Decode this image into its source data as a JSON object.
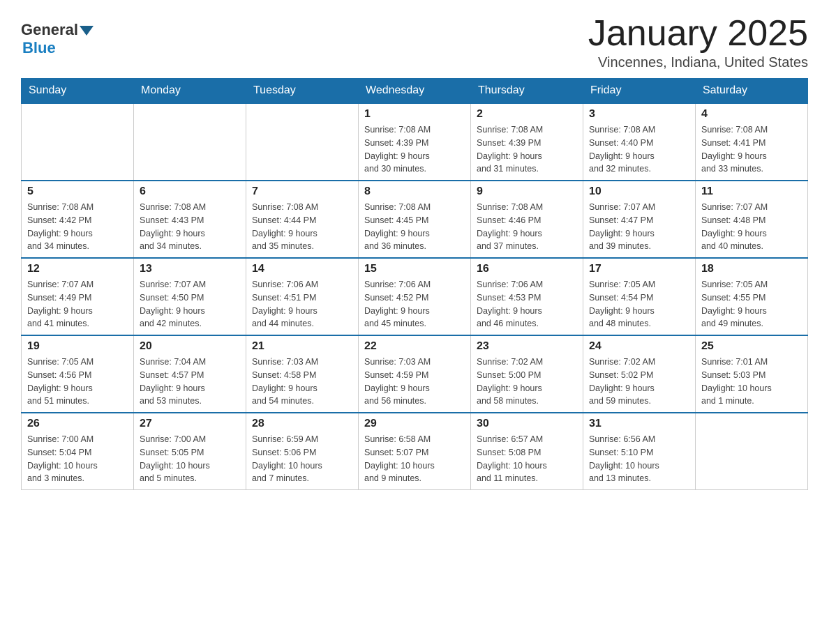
{
  "header": {
    "logo_general": "General",
    "logo_blue": "Blue",
    "month_title": "January 2025",
    "location": "Vincennes, Indiana, United States"
  },
  "days_of_week": [
    "Sunday",
    "Monday",
    "Tuesday",
    "Wednesday",
    "Thursday",
    "Friday",
    "Saturday"
  ],
  "weeks": [
    [
      {
        "day": "",
        "info": ""
      },
      {
        "day": "",
        "info": ""
      },
      {
        "day": "",
        "info": ""
      },
      {
        "day": "1",
        "info": "Sunrise: 7:08 AM\nSunset: 4:39 PM\nDaylight: 9 hours\nand 30 minutes."
      },
      {
        "day": "2",
        "info": "Sunrise: 7:08 AM\nSunset: 4:39 PM\nDaylight: 9 hours\nand 31 minutes."
      },
      {
        "day": "3",
        "info": "Sunrise: 7:08 AM\nSunset: 4:40 PM\nDaylight: 9 hours\nand 32 minutes."
      },
      {
        "day": "4",
        "info": "Sunrise: 7:08 AM\nSunset: 4:41 PM\nDaylight: 9 hours\nand 33 minutes."
      }
    ],
    [
      {
        "day": "5",
        "info": "Sunrise: 7:08 AM\nSunset: 4:42 PM\nDaylight: 9 hours\nand 34 minutes."
      },
      {
        "day": "6",
        "info": "Sunrise: 7:08 AM\nSunset: 4:43 PM\nDaylight: 9 hours\nand 34 minutes."
      },
      {
        "day": "7",
        "info": "Sunrise: 7:08 AM\nSunset: 4:44 PM\nDaylight: 9 hours\nand 35 minutes."
      },
      {
        "day": "8",
        "info": "Sunrise: 7:08 AM\nSunset: 4:45 PM\nDaylight: 9 hours\nand 36 minutes."
      },
      {
        "day": "9",
        "info": "Sunrise: 7:08 AM\nSunset: 4:46 PM\nDaylight: 9 hours\nand 37 minutes."
      },
      {
        "day": "10",
        "info": "Sunrise: 7:07 AM\nSunset: 4:47 PM\nDaylight: 9 hours\nand 39 minutes."
      },
      {
        "day": "11",
        "info": "Sunrise: 7:07 AM\nSunset: 4:48 PM\nDaylight: 9 hours\nand 40 minutes."
      }
    ],
    [
      {
        "day": "12",
        "info": "Sunrise: 7:07 AM\nSunset: 4:49 PM\nDaylight: 9 hours\nand 41 minutes."
      },
      {
        "day": "13",
        "info": "Sunrise: 7:07 AM\nSunset: 4:50 PM\nDaylight: 9 hours\nand 42 minutes."
      },
      {
        "day": "14",
        "info": "Sunrise: 7:06 AM\nSunset: 4:51 PM\nDaylight: 9 hours\nand 44 minutes."
      },
      {
        "day": "15",
        "info": "Sunrise: 7:06 AM\nSunset: 4:52 PM\nDaylight: 9 hours\nand 45 minutes."
      },
      {
        "day": "16",
        "info": "Sunrise: 7:06 AM\nSunset: 4:53 PM\nDaylight: 9 hours\nand 46 minutes."
      },
      {
        "day": "17",
        "info": "Sunrise: 7:05 AM\nSunset: 4:54 PM\nDaylight: 9 hours\nand 48 minutes."
      },
      {
        "day": "18",
        "info": "Sunrise: 7:05 AM\nSunset: 4:55 PM\nDaylight: 9 hours\nand 49 minutes."
      }
    ],
    [
      {
        "day": "19",
        "info": "Sunrise: 7:05 AM\nSunset: 4:56 PM\nDaylight: 9 hours\nand 51 minutes."
      },
      {
        "day": "20",
        "info": "Sunrise: 7:04 AM\nSunset: 4:57 PM\nDaylight: 9 hours\nand 53 minutes."
      },
      {
        "day": "21",
        "info": "Sunrise: 7:03 AM\nSunset: 4:58 PM\nDaylight: 9 hours\nand 54 minutes."
      },
      {
        "day": "22",
        "info": "Sunrise: 7:03 AM\nSunset: 4:59 PM\nDaylight: 9 hours\nand 56 minutes."
      },
      {
        "day": "23",
        "info": "Sunrise: 7:02 AM\nSunset: 5:00 PM\nDaylight: 9 hours\nand 58 minutes."
      },
      {
        "day": "24",
        "info": "Sunrise: 7:02 AM\nSunset: 5:02 PM\nDaylight: 9 hours\nand 59 minutes."
      },
      {
        "day": "25",
        "info": "Sunrise: 7:01 AM\nSunset: 5:03 PM\nDaylight: 10 hours\nand 1 minute."
      }
    ],
    [
      {
        "day": "26",
        "info": "Sunrise: 7:00 AM\nSunset: 5:04 PM\nDaylight: 10 hours\nand 3 minutes."
      },
      {
        "day": "27",
        "info": "Sunrise: 7:00 AM\nSunset: 5:05 PM\nDaylight: 10 hours\nand 5 minutes."
      },
      {
        "day": "28",
        "info": "Sunrise: 6:59 AM\nSunset: 5:06 PM\nDaylight: 10 hours\nand 7 minutes."
      },
      {
        "day": "29",
        "info": "Sunrise: 6:58 AM\nSunset: 5:07 PM\nDaylight: 10 hours\nand 9 minutes."
      },
      {
        "day": "30",
        "info": "Sunrise: 6:57 AM\nSunset: 5:08 PM\nDaylight: 10 hours\nand 11 minutes."
      },
      {
        "day": "31",
        "info": "Sunrise: 6:56 AM\nSunset: 5:10 PM\nDaylight: 10 hours\nand 13 minutes."
      },
      {
        "day": "",
        "info": ""
      }
    ]
  ]
}
